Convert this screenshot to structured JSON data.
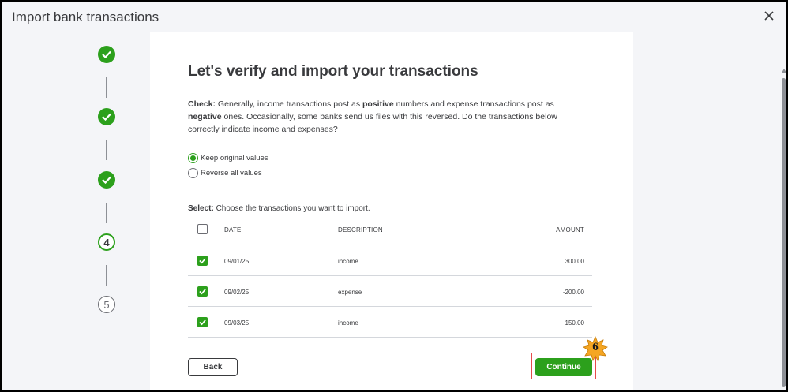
{
  "dialog": {
    "title": "Import bank transactions",
    "close_icon": "close-icon"
  },
  "stepper": {
    "steps": [
      {
        "state": "done",
        "icon": "checkmark-icon"
      },
      {
        "state": "done",
        "icon": "checkmark-icon"
      },
      {
        "state": "done",
        "icon": "checkmark-icon"
      },
      {
        "state": "current",
        "label": "4"
      },
      {
        "state": "future",
        "label": "5"
      }
    ]
  },
  "main": {
    "title": "Let's verify and import your transactions",
    "check": {
      "label": "Check:",
      "text_1": " Generally, income transactions post as ",
      "bold_1": "positive",
      "text_2": " numbers and expense transactions post as ",
      "bold_2": "negative",
      "text_3": " ones. Occasionally, some banks send us files with this reversed. Do the transactions below correctly indicate income and expenses?"
    },
    "radio_options": [
      {
        "label": "Keep original values",
        "selected": true
      },
      {
        "label": "Reverse all values",
        "selected": false
      }
    ],
    "select": {
      "label": "Select:",
      "text": " Choose the transactions you want to import."
    },
    "table": {
      "headers": {
        "date": "DATE",
        "description": "DESCRIPTION",
        "amount": "AMOUNT"
      },
      "select_all_checked": false,
      "rows": [
        {
          "checked": true,
          "date": "09/01/25",
          "description": "income",
          "amount": "300.00"
        },
        {
          "checked": true,
          "date": "09/02/25",
          "description": "expense",
          "amount": "-200.00"
        },
        {
          "checked": true,
          "date": "09/03/25",
          "description": "income",
          "amount": "150.00"
        }
      ]
    }
  },
  "footer": {
    "back_label": "Back",
    "continue_label": "Continue"
  },
  "annotation": {
    "callout_number": "6",
    "highlight_color": "#e64b4b",
    "badge_color": "#f5a623"
  },
  "colors": {
    "accent": "#2ca01c",
    "text": "#393a3d",
    "background": "#f4f5f8"
  }
}
